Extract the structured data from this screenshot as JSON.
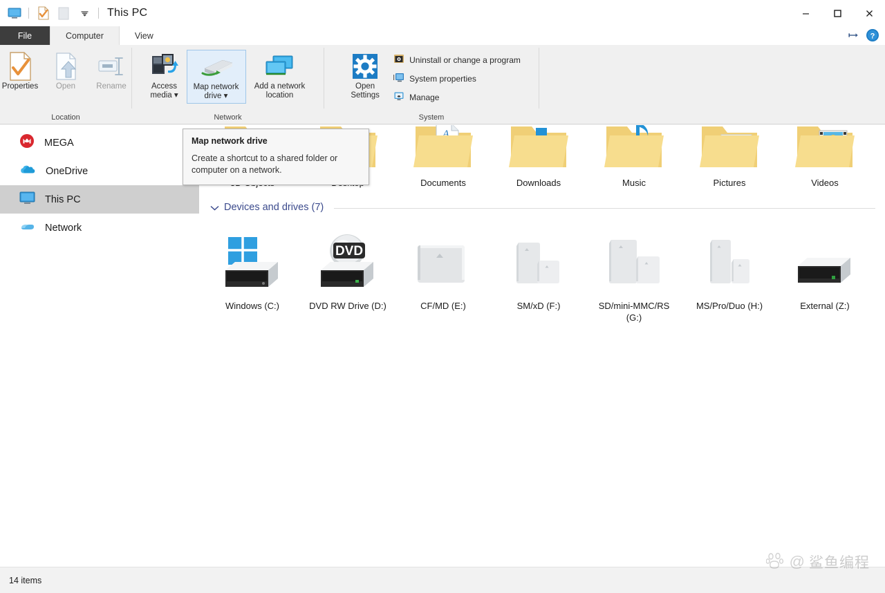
{
  "window": {
    "title": "This PC",
    "quick_access": [
      {
        "name": "this-pc-icon",
        "label": "This PC"
      },
      {
        "name": "properties-icon",
        "label": "Properties"
      },
      {
        "name": "new-folder-icon",
        "label": "New folder"
      },
      {
        "name": "customize-chevron-icon",
        "label": "Customize Quick Access Toolbar"
      }
    ],
    "controls": {
      "minimize": "–",
      "maximize": "☐",
      "close": "✕"
    }
  },
  "tabs": [
    {
      "label": "File",
      "state": "file"
    },
    {
      "label": "Computer",
      "state": "active"
    },
    {
      "label": "View",
      "state": "normal"
    }
  ],
  "tabstrip_right": {
    "collapse_ribbon": "collapse-ribbon-icon",
    "help": "?"
  },
  "ribbon": {
    "groups": [
      {
        "label": "Location",
        "buttons": [
          {
            "label": "Properties",
            "icon": "properties-icon",
            "enabled": true
          },
          {
            "label": "Open",
            "icon": "open-icon",
            "enabled": false
          },
          {
            "label": "Rename",
            "icon": "rename-icon",
            "enabled": false
          }
        ]
      },
      {
        "label": "Network",
        "buttons": [
          {
            "label": "Access media",
            "icon": "access-media-icon",
            "enabled": true,
            "dropdown": true
          },
          {
            "label": "Map network drive",
            "icon": "map-network-drive-icon",
            "enabled": true,
            "dropdown": true,
            "selected": true
          },
          {
            "label": "Add a network location",
            "icon": "add-network-location-icon",
            "enabled": true
          }
        ]
      },
      {
        "label": "System",
        "buttons": [
          {
            "label": "Open Settings",
            "icon": "settings-gear-icon",
            "enabled": true
          }
        ],
        "list": [
          {
            "label": "Uninstall or change a program",
            "icon": "uninstall-program-icon"
          },
          {
            "label": "System properties",
            "icon": "system-properties-icon"
          },
          {
            "label": "Manage",
            "icon": "manage-icon"
          }
        ]
      }
    ]
  },
  "tooltip": {
    "title": "Map network drive",
    "description": "Create a shortcut to a shared folder or computer on a network."
  },
  "sidebar": {
    "items": [
      {
        "label": "MEGA",
        "icon": "mega-icon",
        "selected": false
      },
      {
        "label": "OneDrive",
        "icon": "onedrive-cloud-icon",
        "selected": false
      },
      {
        "label": "This PC",
        "icon": "this-pc-monitor-icon",
        "selected": true
      },
      {
        "label": "Network",
        "icon": "network-icon",
        "selected": false
      }
    ]
  },
  "content": {
    "folders_group": {
      "expanded": true,
      "items": [
        {
          "label": "3D Objects",
          "icon": "folder-3d-objects-icon"
        },
        {
          "label": "Desktop",
          "icon": "folder-desktop-icon"
        },
        {
          "label": "Documents",
          "icon": "folder-documents-icon"
        },
        {
          "label": "Downloads",
          "icon": "folder-downloads-icon"
        },
        {
          "label": "Music",
          "icon": "folder-music-icon"
        },
        {
          "label": "Pictures",
          "icon": "folder-pictures-icon"
        },
        {
          "label": "Videos",
          "icon": "folder-videos-icon"
        }
      ]
    },
    "devices_group": {
      "chevron": "⌄",
      "title": "Devices and drives (7)",
      "items": [
        {
          "label": "Windows (C:)",
          "icon": "hard-drive-windows-icon"
        },
        {
          "label": "DVD RW Drive (D:)",
          "icon": "dvd-rw-drive-icon"
        },
        {
          "label": "CF/MD (E:)",
          "icon": "card-reader-cf-md-icon"
        },
        {
          "label": "SM/xD (F:)",
          "icon": "card-reader-sm-xd-icon"
        },
        {
          "label": "SD/mini-MMC/RS (G:)",
          "icon": "card-reader-sd-mmc-icon"
        },
        {
          "label": "MS/Pro/Duo (H:)",
          "icon": "card-reader-ms-pro-duo-icon"
        },
        {
          "label": "External (Z:)",
          "icon": "external-drive-icon"
        }
      ]
    }
  },
  "statusbar": {
    "item_count": "14 items"
  },
  "watermark": {
    "text": "鲨鱼编程",
    "prefix": "@"
  },
  "colors": {
    "accent": "#0078d7",
    "folder": "#f5d77e",
    "group_header": "#3b4a8c",
    "selection": "#cfcfcf",
    "ribbon_selected_bg": "#e2eefa"
  }
}
